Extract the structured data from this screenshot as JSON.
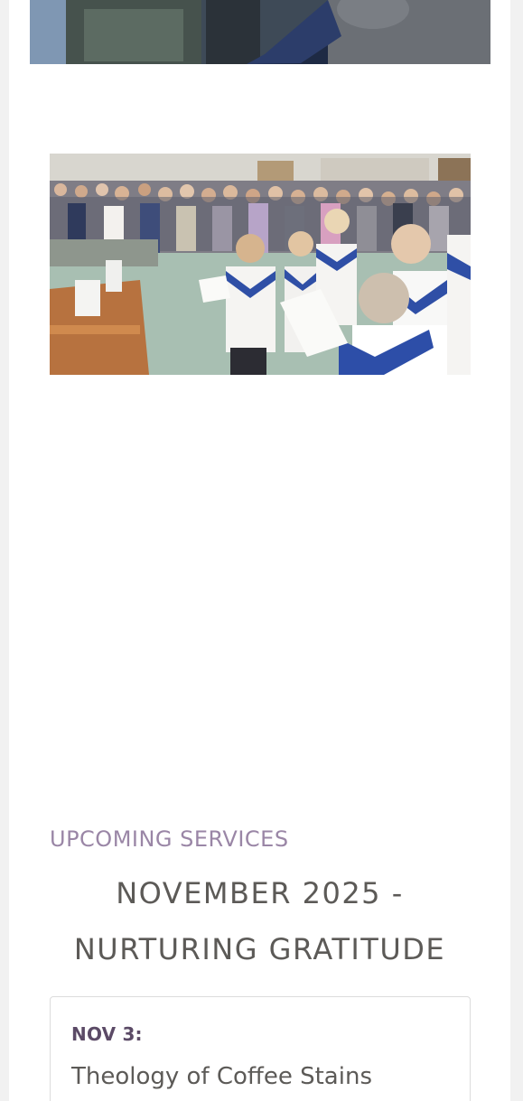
{
  "upcoming": {
    "section_label": "UPCOMING SERVICES",
    "month_title": "NOVEMBER 2025 - NURTURING GRATITUDE"
  },
  "services": [
    {
      "date": "NOV 3:",
      "title": "Theology of Coffee Stains"
    }
  ]
}
